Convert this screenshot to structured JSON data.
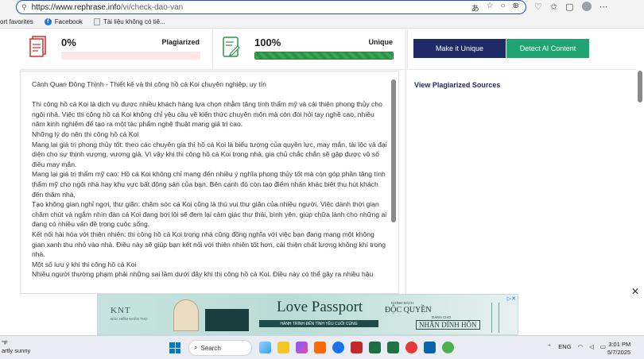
{
  "browser": {
    "url_main": "https://www.rephrase.info",
    "url_path": "/vi/check-dao-van",
    "omni_icons": [
      "read-aloud-icon",
      "add-favorite-icon",
      "circle-icon",
      "collections-icon"
    ],
    "bookmarks": [
      {
        "label": "ort favorites"
      },
      {
        "label": "Facebook"
      },
      {
        "label": "Tài liệu không có tiê..."
      }
    ]
  },
  "stats": {
    "plagiarized": {
      "percent": "0%",
      "label": "Plagiarized",
      "fill": 0
    },
    "unique": {
      "percent": "100%",
      "label": "Unique",
      "fill": 100
    }
  },
  "actions": {
    "make_unique": "Make it Unique",
    "detect_ai": "Detect AI Content"
  },
  "document_text": "Cảnh Quan Đông Thịnh - Thiết kế và thi công hồ cá Koi chuyên nghiệp, uy tín\n\nThi công hồ cá Koi là dịch vụ được nhiều khách hàng lựa chọn nhằm tăng tính thẩm mỹ và cải thiện phong thủy cho ngôi nhà. Việc thi công hồ cá Koi không chỉ yêu cầu về kiến thức chuyên môn mà còn đòi hỏi tay nghề cao, nhiều năm kinh nghiệm để tạo ra một tác phẩm nghệ thuật mang giá trị cao.\nNhững lý do nên thi công hồ cá Koi\nMang lại giá trị phong thủy tốt: theo các chuyên gia thì hồ cá Koi là biểu tượng của quyền lực, may mắn, tài lộc và đại diện cho sự thịnh vượng, vương giả. Vì vậy khi thi công hồ cá Koi trong nhà, gia chủ chắc chắn sẽ gặp được vô số điều may mắn.\nMang lại giá trị thẩm mỹ cao: Hồ cá Koi không chỉ mang đến nhiều ý nghĩa phong thủy tốt mà còn góp phần tăng tính thẩm mỹ cho ngôi nhà hay khu vực bất động sản của bạn. Bên cạnh đó còn tạo điểm nhấn khác biệt thu hút khách đến thăm nhà,\nTạo không gian nghỉ ngơi, thư giãn: chăm sóc cá Koi cũng là thú vui thư giãn của nhiều người. Việc dành thời gian chăm chút và ngắm nhìn đàn cá Koi đang bơi lội sẽ đem lại cảm giác thư thái, bình yên, giúp chữa lành cho những ai đang có nhiều vấn đề trong cuộc sống.\nKết nối hài hòa với thiên nhiên: thi công hồ cá Koi trong nhà cũng đồng nghĩa với việc bạn đang mang một không gian xanh thu nhỏ vào nhà. Điều này sẽ giúp bạn kết nối với thiên nhiên tốt hơn, cải thiện chất lượng không khí trong nhà.\nMột số lưu ý khi thi công hồ cá Koi\nNhiều người thường phạm phải những sai lầm dưới đây khi thi công hồ cá Koi. Điều này có thể gây ra nhiều hậu",
  "sidebar": {
    "title": "View Plagiarized Sources"
  },
  "ad": {
    "brand": "KNT",
    "brand_sub": "BẢO HIỂM NHÂN THỌ",
    "title": "Love Passport",
    "band": "HÀNH TRÌNH ĐẾN TÌNH YÊU CUỐI CÙNG",
    "small1": "CHÍNH SÁCH",
    "big1": "ĐỘC QUYỀN",
    "small2": "DÀNH CHO",
    "big2": "NHÂN DÍNH HÔN",
    "close": "✕"
  },
  "taskbar": {
    "temp": "°F",
    "weather": "artly sunny",
    "search": "Search",
    "lang": "ENG",
    "time": "3:01 PM",
    "date": "5/7/2025"
  },
  "colors": {
    "accent_blue": "#1e2a66",
    "accent_green": "#20a472",
    "progress_green": "#34a853",
    "plagiarized_track": "#fde7e7"
  }
}
